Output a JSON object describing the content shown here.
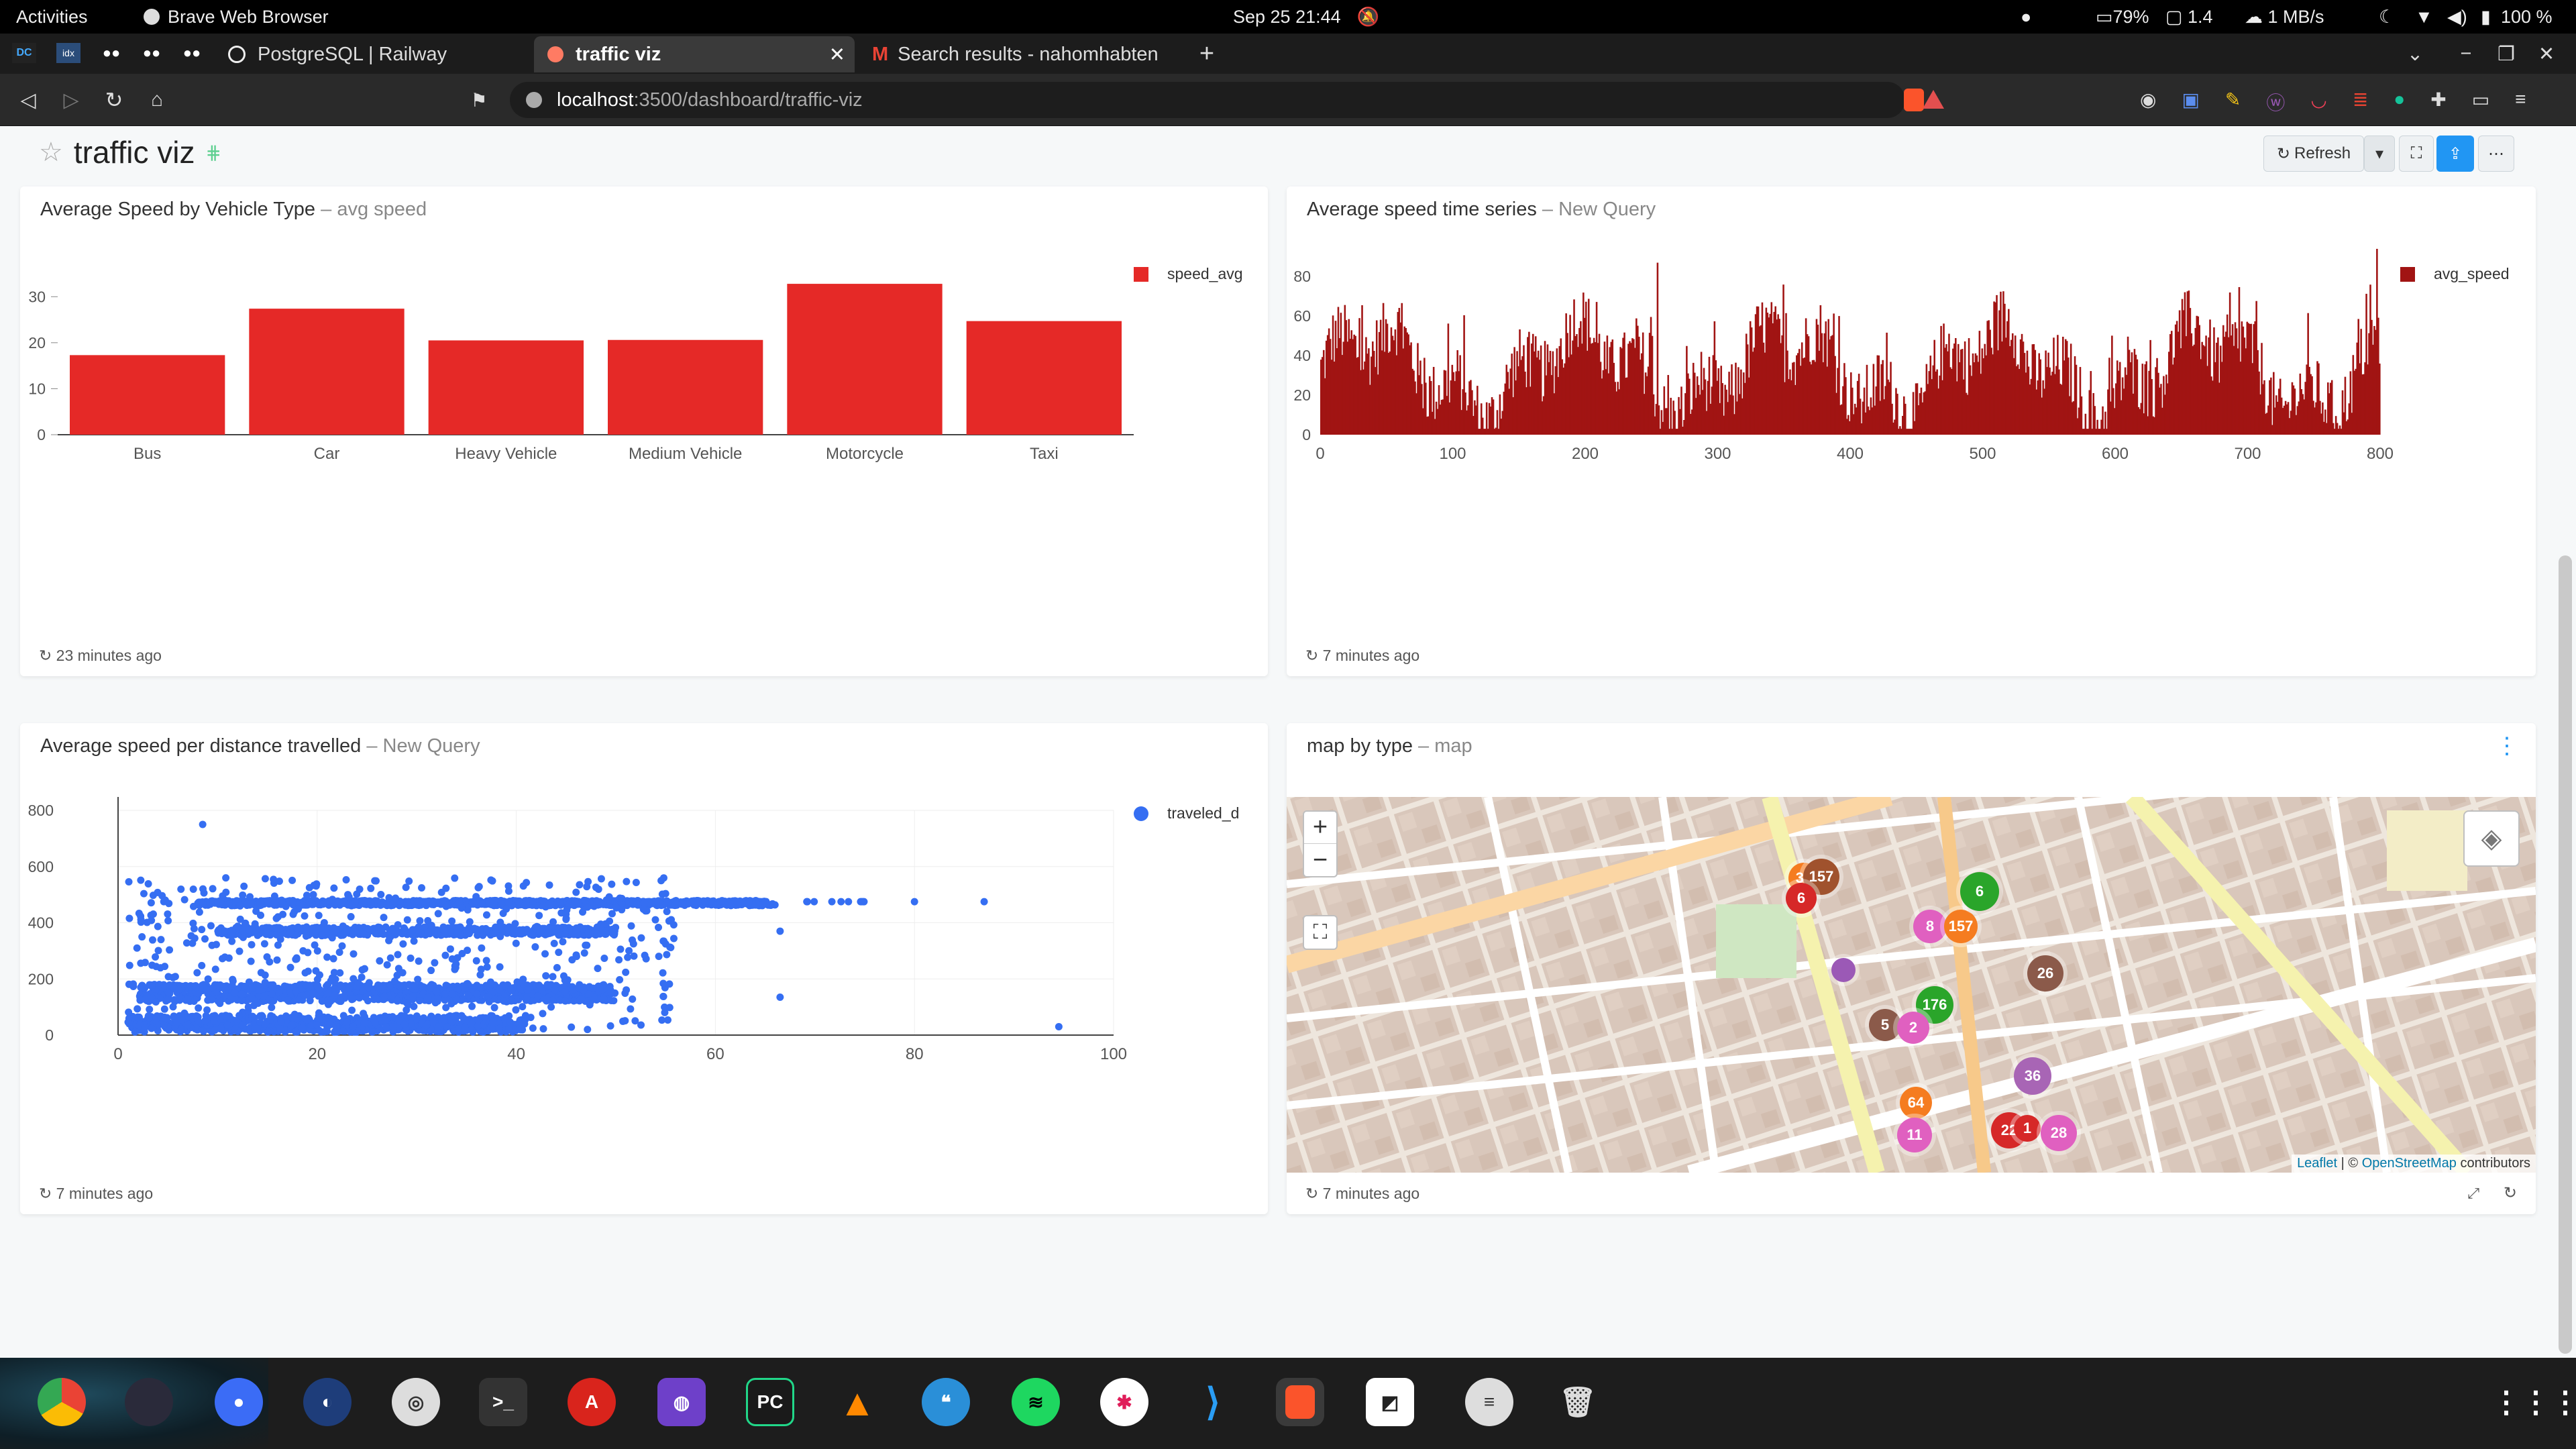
{
  "system": {
    "activities": "Activities",
    "app_name": "Brave Web Browser",
    "datetime": "Sep 25  21:44",
    "battery_hist": "79%",
    "cpu": "1.4",
    "net": "1 MB/s",
    "battery": "100 %"
  },
  "tabs": [
    {
      "label": "PostgreSQL | Railway"
    },
    {
      "label": "traffic viz"
    },
    {
      "label": "Search results - nahomhabten"
    }
  ],
  "address": {
    "host": "localhost",
    "path": ":3500/dashboard/traffic-viz"
  },
  "dashboard": {
    "title": "traffic viz",
    "refresh_label": "Refresh"
  },
  "widgets": [
    {
      "title": "Average Speed by Vehicle Type",
      "subtitle": "avg speed",
      "updated": "23 minutes ago"
    },
    {
      "title": "Average speed time series",
      "subtitle": "New Query",
      "updated": "7 minutes ago"
    },
    {
      "title": "Average speed per distance travelled",
      "subtitle": "New Query",
      "updated": "7 minutes ago"
    },
    {
      "title": "map by type",
      "subtitle": "map",
      "updated": "7 minutes ago"
    }
  ],
  "chart_data": [
    {
      "type": "bar",
      "categories": [
        "Bus",
        "Car",
        "Heavy Vehicle",
        "Medium Vehicle",
        "Motorcycle",
        "Taxi"
      ],
      "series": [
        {
          "name": "speed_avg",
          "values": [
            17.3,
            27.4,
            20.5,
            20.6,
            32.8,
            24.7
          ]
        }
      ],
      "ylim": [
        0,
        35
      ],
      "yticks": [
        0,
        10,
        20,
        30
      ],
      "color": "#e52927",
      "legend": "top-right"
    },
    {
      "type": "bar",
      "x_range": [
        0,
        800
      ],
      "xticks": [
        0,
        100,
        200,
        300,
        400,
        500,
        600,
        700,
        800
      ],
      "yticks": [
        0,
        20,
        40,
        60,
        80
      ],
      "ylim": [
        0,
        95
      ],
      "series": [
        {
          "name": "avg_speed"
        }
      ],
      "color": "#a11413",
      "legend": "top-right"
    },
    {
      "type": "scatter",
      "xlim": [
        0,
        100
      ],
      "ylim": [
        0,
        800
      ],
      "xticks": [
        0,
        20,
        40,
        60,
        80,
        100
      ],
      "yticks": [
        0,
        200,
        400,
        600,
        800
      ],
      "series": [
        {
          "name": "traveled_d"
        }
      ],
      "color": "#356ef2",
      "outliers": [
        [
          8.5,
          750
        ],
        [
          80,
          475
        ],
        [
          87,
          475
        ],
        [
          66.5,
          370
        ],
        [
          66.5,
          135
        ],
        [
          94.5,
          30
        ]
      ],
      "legend": "top-right"
    }
  ],
  "map": {
    "attribution_leaflet": "Leaflet",
    "attribution_sep": " | © ",
    "attribution_osm": "OpenStreetMap",
    "attribution_tail": " contributors",
    "zoom_in": "+",
    "zoom_out": "−",
    "clusters": [
      "38",
      "157",
      "6",
      "8",
      "157",
      "6",
      "176",
      "26",
      "5",
      "2",
      "36",
      "64",
      "11",
      "22",
      "1",
      "28"
    ]
  }
}
